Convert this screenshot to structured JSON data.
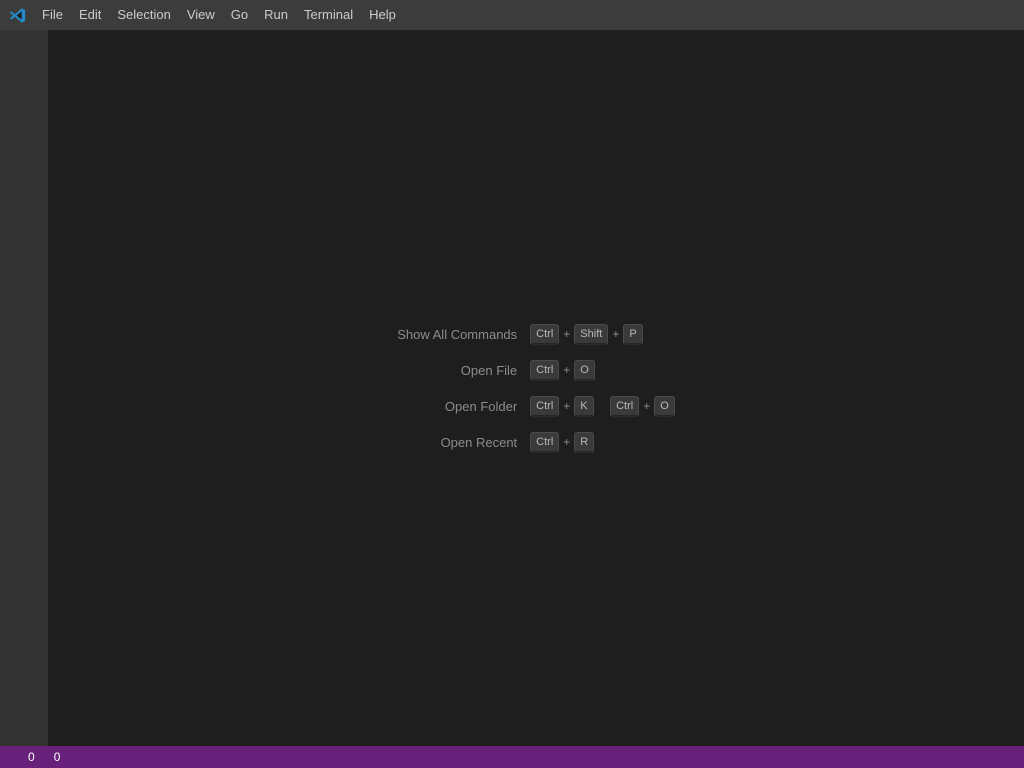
{
  "window": {
    "background": "#1e1e1e",
    "titlebar_background": "#3c3c3c",
    "activitybar_background": "#333333",
    "statusbar_background": "#68217a"
  },
  "titlebar": {
    "logo_name": "vscode-logo-icon",
    "menus": [
      {
        "label": "File"
      },
      {
        "label": "Edit"
      },
      {
        "label": "Selection"
      },
      {
        "label": "View"
      },
      {
        "label": "Go"
      },
      {
        "label": "Run"
      },
      {
        "label": "Terminal"
      },
      {
        "label": "Help"
      }
    ]
  },
  "activitybar": {
    "items": []
  },
  "editor": {
    "watermark": {
      "entries": [
        {
          "label": "Show All Commands",
          "chords": [
            {
              "keys": [
                "Ctrl",
                "Shift",
                "P"
              ]
            }
          ]
        },
        {
          "label": "Open File",
          "chords": [
            {
              "keys": [
                "Ctrl",
                "O"
              ]
            }
          ]
        },
        {
          "label": "Open Folder",
          "chords": [
            {
              "keys": [
                "Ctrl",
                "K"
              ]
            },
            {
              "keys": [
                "Ctrl",
                "O"
              ]
            }
          ]
        },
        {
          "label": "Open Recent",
          "chords": [
            {
              "keys": [
                "Ctrl",
                "R"
              ]
            }
          ]
        }
      ],
      "separator": "+"
    }
  },
  "statusbar": {
    "left_items": [
      {
        "icon": "error-icon",
        "value": "0",
        "name": "error-count"
      },
      {
        "icon": "warning-icon",
        "value": "0",
        "name": "warning-count"
      }
    ],
    "right_items": []
  }
}
